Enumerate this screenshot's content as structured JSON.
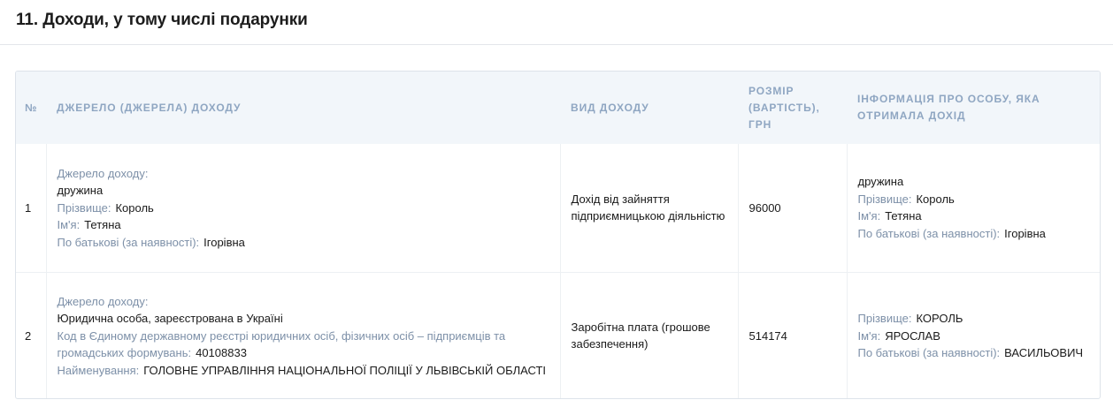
{
  "section": {
    "title": "11. Доходи, у тому числі подарунки"
  },
  "table": {
    "headers": {
      "num": "№",
      "source": "Джерело (джерела) доходу",
      "type": "Вид доходу",
      "amount": "Розмір (вартість), грн",
      "recipient": "Інформація про особу, яка отримала дохід"
    },
    "rows": [
      {
        "num": "1",
        "source": {
          "label": "Джерело доходу:",
          "value": "дружина",
          "surname_label": "Прізвище:",
          "surname": "Король",
          "name_label": "Ім'я:",
          "name": "Тетяна",
          "patronymic_label": "По батькові (за наявності):",
          "patronymic": "Ігорівна"
        },
        "type": "Дохід від зайняття підприємницькою діяльністю",
        "amount": "96000",
        "recipient": {
          "relation": "дружина",
          "surname_label": "Прізвище:",
          "surname": "Король",
          "name_label": "Ім'я:",
          "name": "Тетяна",
          "patronymic_label": "По батькові (за наявності):",
          "patronymic": "Ігорівна"
        }
      },
      {
        "num": "2",
        "source": {
          "label": "Джерело доходу:",
          "value": "Юридична особа, зареєстрована в Україні",
          "code_label": "Код в Єдиному державному реєстрі юридичних осіб, фізичних осіб – підприємців та громадських формувань:",
          "code": "40108833",
          "org_label": "Найменування:",
          "org": "ГОЛОВНЕ УПРАВЛІННЯ НАЦІОНАЛЬНОЇ ПОЛІЦІЇ У ЛЬВІВСЬКІЙ ОБЛАСТІ"
        },
        "type": "Заробітна плата (грошове забезпечення)",
        "amount": "514174",
        "recipient": {
          "surname_label": "Прізвище:",
          "surname": "КОРОЛЬ",
          "name_label": "Ім'я:",
          "name": "ЯРОСЛАВ",
          "patronymic_label": "По батькові (за наявності):",
          "patronymic": "ВАСИЛЬОВИЧ"
        }
      }
    ]
  },
  "colors": {
    "label": "#7d90a8",
    "header_text": "#8fa6c2",
    "header_bg": "#f2f6fa"
  }
}
